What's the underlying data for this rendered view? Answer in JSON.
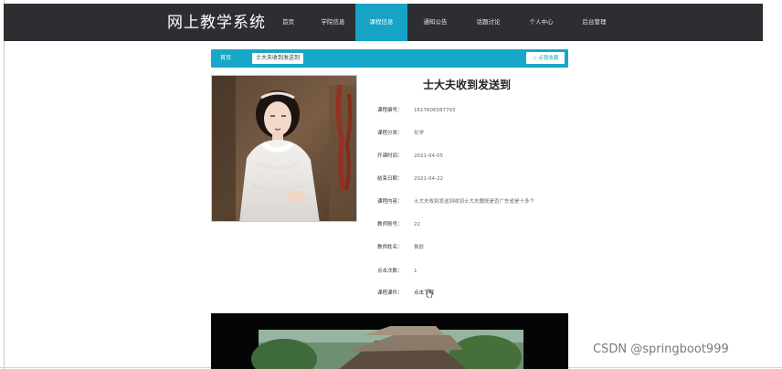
{
  "site": {
    "title": "网上教学系统"
  },
  "nav": {
    "items": [
      {
        "label": "首页",
        "active": false
      },
      {
        "label": "学院信息",
        "active": false
      },
      {
        "label": "课程信息",
        "active": true
      },
      {
        "label": "通知公告",
        "active": false
      },
      {
        "label": "话题讨论",
        "active": false
      },
      {
        "label": "个人中心",
        "active": false
      },
      {
        "label": "后台管理",
        "active": false
      }
    ]
  },
  "breadcrumb": {
    "home": "首页",
    "current": "士大夫收到发送到"
  },
  "actions": {
    "favorite_label": "点我收藏"
  },
  "course": {
    "title": "士大夫收到发送到",
    "fields": [
      {
        "label": "课程编号：",
        "value": "1617606587793"
      },
      {
        "label": "课程分类：",
        "value": "化学"
      },
      {
        "label": "开课时间：",
        "value": "2021-04-05"
      },
      {
        "label": "结束日期：",
        "value": "2021-04-22"
      },
      {
        "label": "课程内容：",
        "value": "士大夫收到发送到收到士大夫撒既是否广东省是十多个"
      },
      {
        "label": "教师账号：",
        "value": "22"
      },
      {
        "label": "教师姓名：",
        "value": "鲁欧"
      },
      {
        "label": "点击次数：",
        "value": "1"
      },
      {
        "label": "课程课件：",
        "value": "点击下载",
        "is_link": true
      }
    ]
  },
  "watermark": "CSDN @springboot999",
  "colors": {
    "nav_bg": "#2c2e31",
    "accent": "#16a3c6",
    "text_dark": "#222222",
    "text_muted": "#666666"
  }
}
